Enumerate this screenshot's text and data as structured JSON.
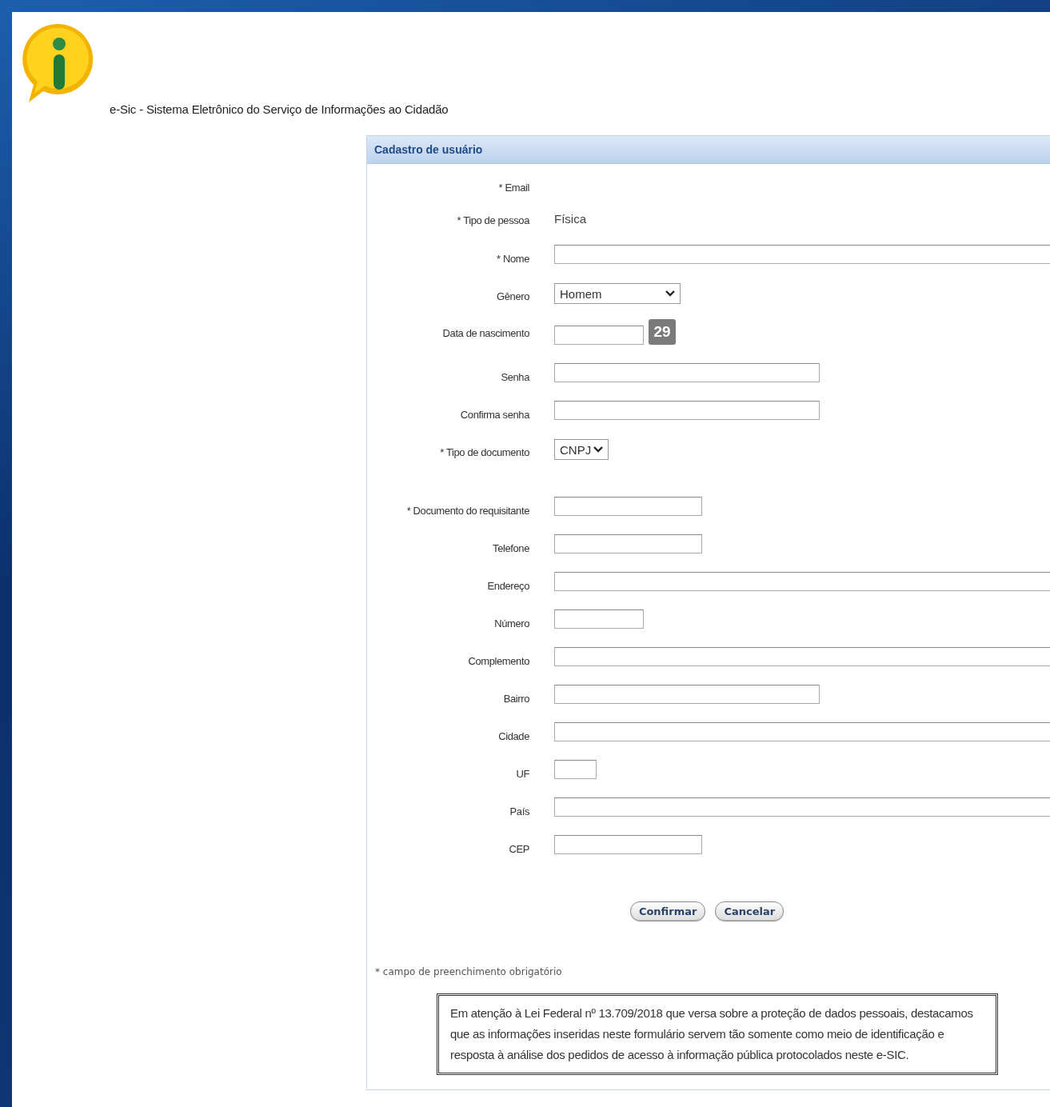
{
  "header": {
    "title": "e-Sic - Sistema Eletrônico do Serviço de Informações ao Cidadão"
  },
  "panel": {
    "title": "Cadastro de usuário",
    "fields": [
      {
        "label": "* Email",
        "kind": "empty"
      },
      {
        "label": "* Tipo de pessoa",
        "kind": "static",
        "value": "Física"
      },
      {
        "label": "* Nome",
        "kind": "input"
      },
      {
        "label": "Gênero",
        "kind": "select",
        "value": "Homem"
      },
      {
        "label": "Data de nascimento",
        "kind": "date",
        "calendar_day": "29"
      },
      {
        "label": "Senha",
        "kind": "input"
      },
      {
        "label": "Confirma senha",
        "kind": "input"
      },
      {
        "label": "* Tipo de documento",
        "kind": "select",
        "value": "CNPJ"
      },
      {
        "label": "* Documento do requisitante",
        "kind": "input"
      },
      {
        "label": "Telefone",
        "kind": "input"
      },
      {
        "label": "Endereço",
        "kind": "input"
      },
      {
        "label": "Número",
        "kind": "input"
      },
      {
        "label": "Complemento",
        "kind": "input"
      },
      {
        "label": "Bairro",
        "kind": "input"
      },
      {
        "label": "Cidade",
        "kind": "input"
      },
      {
        "label": "UF",
        "kind": "input"
      },
      {
        "label": "País",
        "kind": "input"
      },
      {
        "label": "CEP",
        "kind": "input"
      }
    ],
    "buttons": [
      "Confirmar",
      "Cancelar"
    ],
    "footnote": "* campo de preenchimento obrigatório",
    "notice": "Em atenção à Lei Federal nº 13.709/2018 que versa sobre a proteção de dados pessoais, destacamos que as informações inseridas neste formulário servem tão somente como meio de identificação e resposta à análise dos pedidos de acesso à informação pública protocolados neste e-SIC."
  }
}
